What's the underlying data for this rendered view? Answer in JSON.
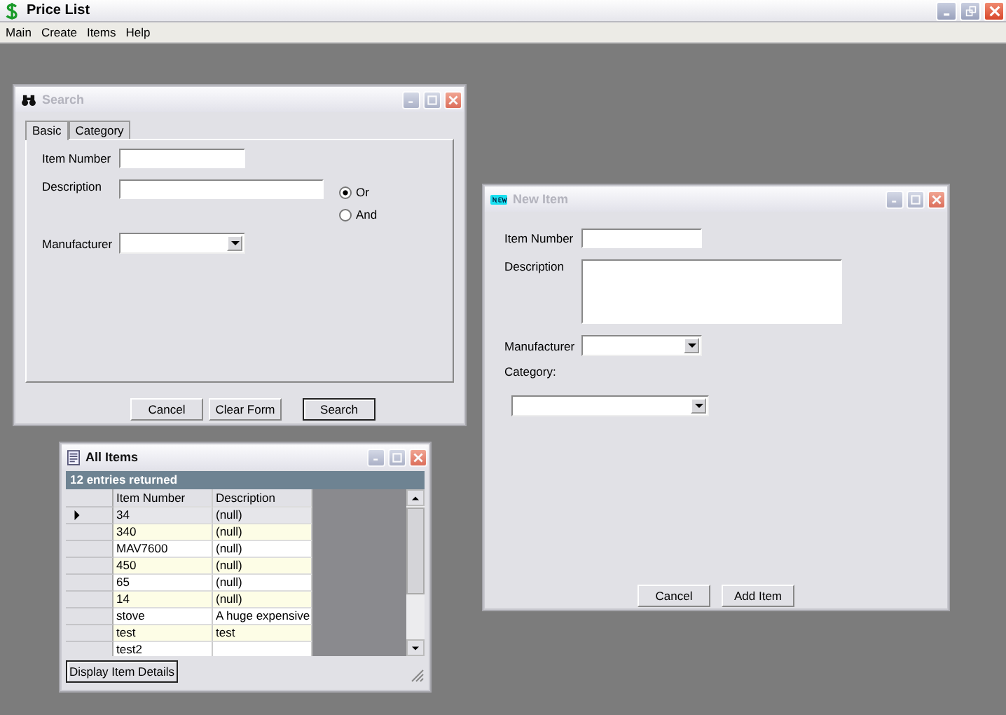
{
  "app": {
    "title": "Price List",
    "menu": [
      "Main",
      "Create",
      "Items",
      "Help"
    ]
  },
  "search_window": {
    "title": "Search",
    "active": false,
    "tabs": [
      {
        "label": "Basic",
        "selected": true
      },
      {
        "label": "Category",
        "selected": false
      }
    ],
    "item_number_label": "Item Number",
    "description_label": "Description",
    "manufacturer_label": "Manufacturer",
    "match": [
      {
        "label": "Or",
        "selected": true
      },
      {
        "label": "And",
        "selected": false
      }
    ],
    "buttons": [
      "Cancel",
      "Clear Form",
      "Search"
    ]
  },
  "all_items_window": {
    "title": "All Items",
    "active": true,
    "status": "12 entries returned",
    "columns": [
      "Item Number",
      "Description"
    ],
    "rows": [
      {
        "cells": [
          "34",
          "(null)"
        ],
        "selected": true
      },
      {
        "cells": [
          "340",
          "(null)"
        ],
        "selected": false
      },
      {
        "cells": [
          "MAV7600",
          "(null)"
        ],
        "selected": false
      },
      {
        "cells": [
          "450",
          "(null)"
        ],
        "selected": false
      },
      {
        "cells": [
          "65",
          "(null)"
        ],
        "selected": false
      },
      {
        "cells": [
          "14",
          "(null)"
        ],
        "selected": false
      },
      {
        "cells": [
          "stove",
          "A huge expensive"
        ],
        "selected": false
      },
      {
        "cells": [
          "test",
          "test"
        ],
        "selected": false
      },
      {
        "cells": [
          "test2",
          ""
        ],
        "selected": false
      }
    ],
    "button": "Display Item Details"
  },
  "new_item_window": {
    "title": "New Item",
    "active": false,
    "item_number_label": "Item Number",
    "description_label": "Description",
    "manufacturer_label": "Manufacturer",
    "category_label": "Category:",
    "buttons": [
      "Cancel",
      "Add Item"
    ]
  }
}
